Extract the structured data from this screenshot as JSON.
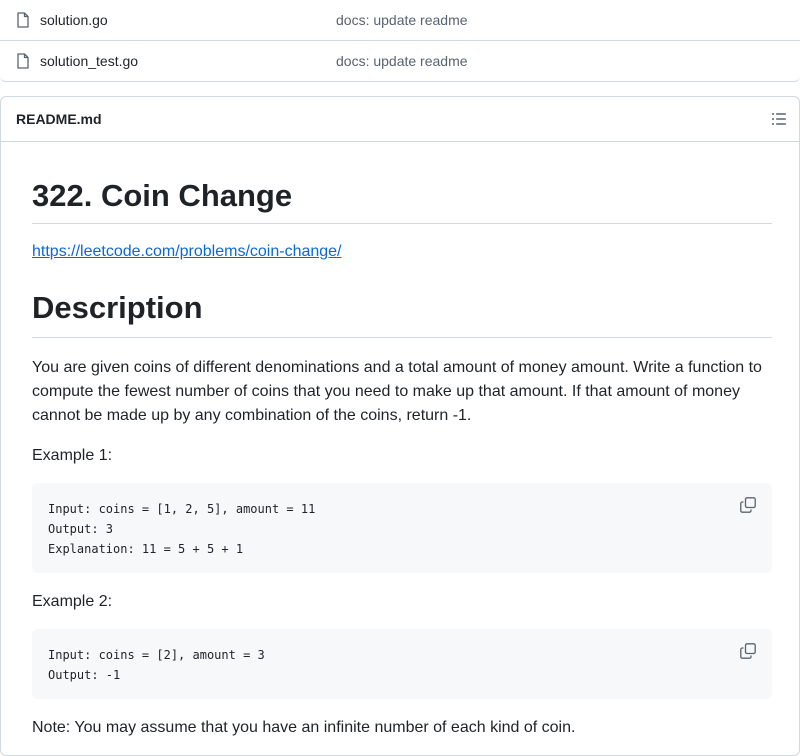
{
  "files": [
    {
      "name": "solution.go",
      "commit": "docs: update readme",
      "icon": "file-icon"
    },
    {
      "name": "solution_test.go",
      "commit": "docs: update readme",
      "icon": "file-icon"
    }
  ],
  "readme": {
    "title": "README.md",
    "outline_icon": "list-unordered-icon"
  },
  "content": {
    "heading": "322. Coin Change",
    "link": "https://leetcode.com/problems/coin-change/",
    "description_heading": "Description",
    "description": "You are given coins of different denominations and a total amount of money amount. Write a function to compute the fewest number of coins that you need to make up that amount. If that amount of money cannot be made up by any combination of the coins, return -1.",
    "example1_label": "Example 1:",
    "example1_lines": [
      "Input: coins = [1, 2, 5], amount = 11",
      "Output: 3",
      "Explanation: 11 = 5 + 5 + 1"
    ],
    "example2_label": "Example 2:",
    "example2_lines": [
      "Input: coins = [2], amount = 3",
      "Output: -1"
    ],
    "note": "Note: You may assume that you have an infinite number of each kind of coin."
  },
  "colors": {
    "link": "#0969da",
    "border": "#d1d9e0",
    "muted": "#59636e",
    "code_bg": "#f6f8fa"
  }
}
